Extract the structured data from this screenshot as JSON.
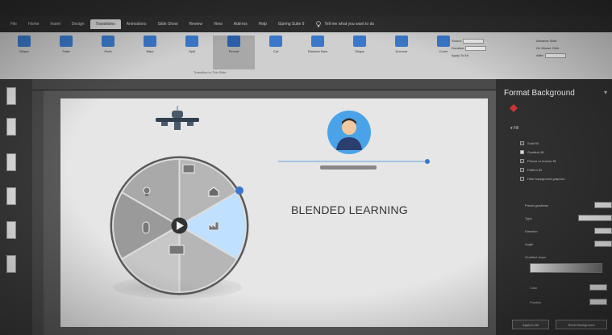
{
  "ribbon": {
    "tabs": [
      "File",
      "Home",
      "Insert",
      "Design",
      "Transitions",
      "Animations",
      "Slide Show",
      "Review",
      "View",
      "Add-ins",
      "Help",
      "iSpring Suite 9"
    ],
    "active_tab_index": 4,
    "tell_me": "Tell me what you want to do",
    "buttons": [
      {
        "label": "Morph",
        "icon": "morph-icon"
      },
      {
        "label": "Fade",
        "icon": "fade-icon"
      },
      {
        "label": "Push",
        "icon": "push-icon"
      },
      {
        "label": "Wipe",
        "icon": "wipe-icon"
      },
      {
        "label": "Split",
        "icon": "split-icon"
      },
      {
        "label": "Reveal",
        "icon": "reveal-icon"
      },
      {
        "label": "Cut",
        "icon": "cut-icon"
      },
      {
        "label": "Random Bars",
        "icon": "random-bars-icon"
      },
      {
        "label": "Shape",
        "icon": "shape-icon"
      },
      {
        "label": "Uncover",
        "icon": "uncover-icon"
      },
      {
        "label": "Cover",
        "icon": "cover-icon"
      },
      {
        "label": "Effect Options",
        "icon": "effect-options-icon"
      }
    ],
    "active_button_index": 5,
    "group_label": "Transition to This Slide",
    "timing": {
      "sound_label": "Sound:",
      "sound_value": "[No Sound]",
      "duration_label": "Duration:",
      "duration_value": "01.00",
      "apply_label": "Apply To All",
      "advance_label": "Advance Slide",
      "on_click_label": "On Mouse Click",
      "after_label": "After:",
      "after_value": "00:00.00"
    }
  },
  "slide": {
    "headline": "BLENDED LEARNING"
  },
  "format_pane": {
    "title": "Format Background",
    "section": "Fill",
    "fill_options": [
      {
        "label": "Solid fill",
        "checked": false
      },
      {
        "label": "Gradient fill",
        "checked": true
      },
      {
        "label": "Picture or texture fill",
        "checked": false
      },
      {
        "label": "Pattern fill",
        "checked": false
      },
      {
        "label": "Hide background graphics",
        "checked": false
      }
    ],
    "fields": [
      {
        "label": "Preset gradients",
        "value": ""
      },
      {
        "label": "Type",
        "value": "Linear"
      },
      {
        "label": "Direction",
        "value": ""
      },
      {
        "label": "Angle",
        "value": "90°"
      },
      {
        "label": "Gradient stops",
        "value": ""
      }
    ],
    "color_label": "Color",
    "position_label": "Position",
    "position_value": "0%",
    "apply_all_label": "Apply to All",
    "reset_label": "Reset Background",
    "colors": {
      "pane_bg": "#2f2f2f",
      "accent": "#3a78c9"
    }
  }
}
